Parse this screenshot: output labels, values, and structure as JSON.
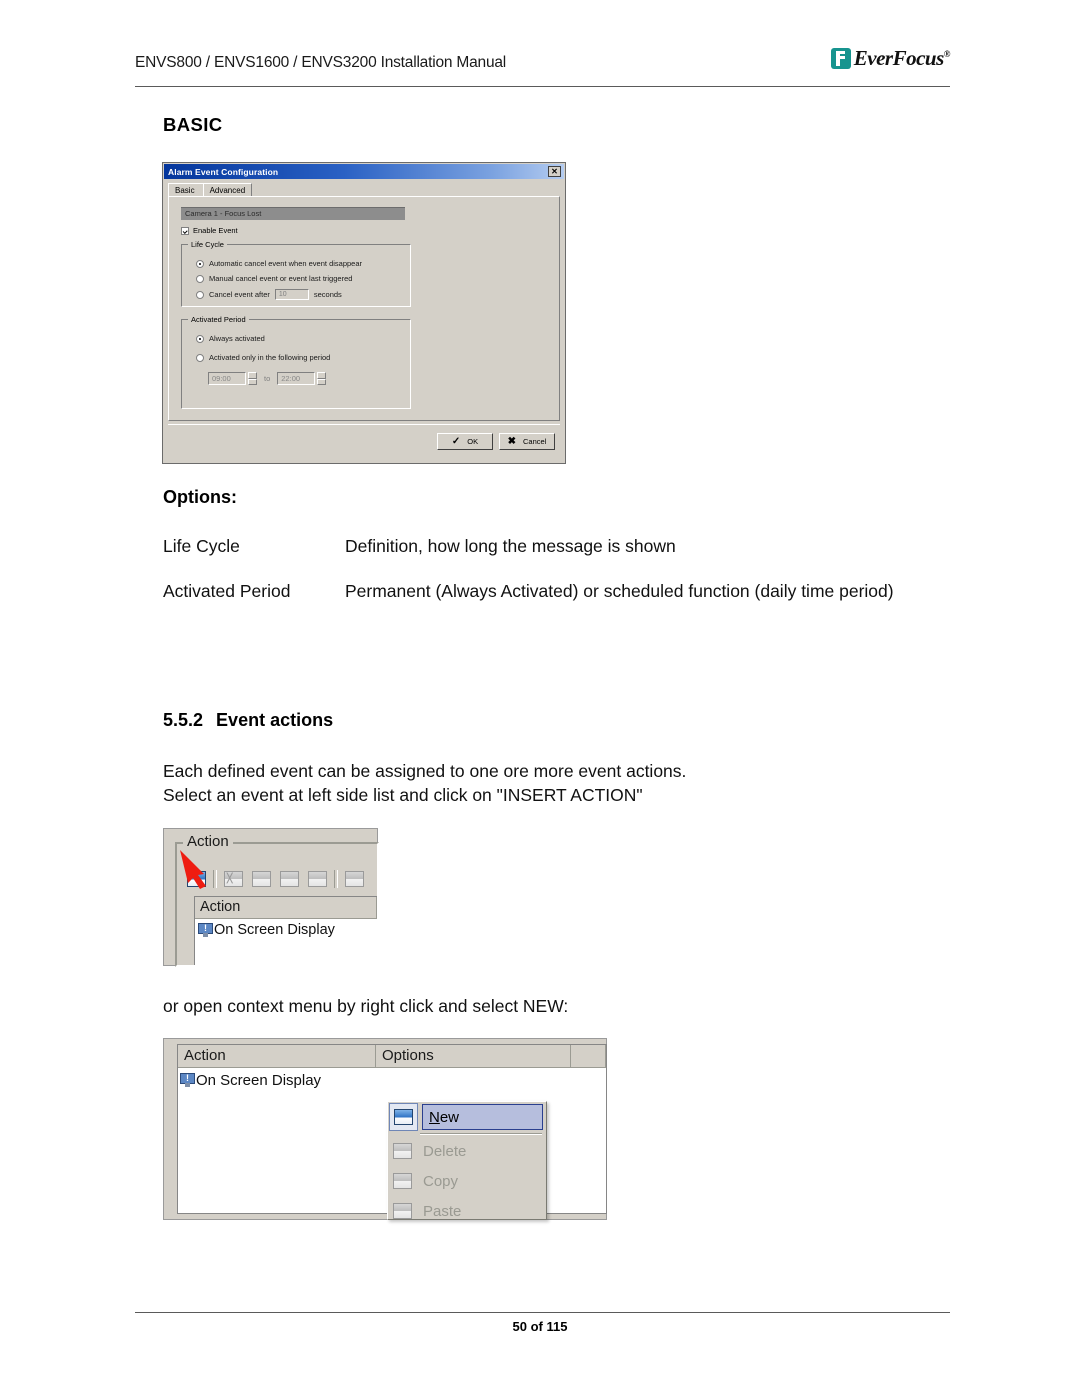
{
  "header": {
    "title": "ENVS800 / ENVS1600 / ENVS3200 Installation Manual",
    "brand_name": "EverFocus",
    "brand_reg": "®",
    "brand_color": "#17948f"
  },
  "footer": {
    "page_label": "50 of 115"
  },
  "body": {
    "basic_heading": "BASIC",
    "options_heading": "Options:",
    "options": [
      {
        "term": "Life Cycle",
        "definition": "Definition, how long the message is shown"
      },
      {
        "term": "Activated Period",
        "definition": "Permanent (Always Activated)  or scheduled function (daily time period)"
      }
    ],
    "section_number": "5.5.2",
    "section_title": "Event actions",
    "paragraph_intro": "Each defined event can be assigned to one ore more event actions.\nSelect an event at left side list and click on \"INSERT ACTION\"",
    "paragraph_context": "or open context menu by right click and select NEW:"
  },
  "dialog": {
    "title": "Alarm Event Configuration",
    "close_label": "✕",
    "tabs": [
      {
        "label": "Basic",
        "active": true
      },
      {
        "label": "Advanced",
        "active": false
      }
    ],
    "event_label": "Camera 1 - Focus Lost",
    "enable_event_label": "Enable Event",
    "life_cycle": {
      "title": "Life Cycle",
      "options": [
        {
          "label": "Automatic cancel event when event disappear",
          "selected": true
        },
        {
          "label": "Manual cancel event or event last triggered",
          "selected": false
        },
        {
          "label": "Cancel event after",
          "selected": false
        }
      ],
      "seconds_value": "10",
      "seconds_label": "seconds"
    },
    "activated_period": {
      "title": "Activated Period",
      "options": [
        {
          "label": "Always activated",
          "selected": true
        },
        {
          "label": "Activated only in the following period",
          "selected": false
        }
      ],
      "start_time": "09:00",
      "to_label": "to",
      "end_time": "22:00"
    },
    "buttons": [
      {
        "label": "OK",
        "glyph": "✓"
      },
      {
        "label": "Cancel",
        "glyph": "✖"
      }
    ]
  },
  "action_panel": {
    "group_title": "Action",
    "toolbar_icons": [
      "new-action-icon",
      "delete-action-icon",
      "copy-action-icon",
      "paste-action-icon",
      "export-action-icon",
      "properties-action-icon"
    ],
    "list_header": "Action",
    "items": [
      {
        "label": "On Screen Display"
      }
    ]
  },
  "context_panel": {
    "columns": [
      "Action",
      "Options",
      ""
    ],
    "items": [
      {
        "label": "On Screen Display"
      }
    ],
    "menu": [
      {
        "label": "New",
        "accel": "N",
        "enabled": true
      },
      {
        "label": "Delete",
        "accel": "D",
        "enabled": false
      },
      {
        "label": "Copy",
        "accel": "C",
        "enabled": false
      },
      {
        "label": "Paste",
        "accel": "P",
        "enabled": false
      }
    ]
  }
}
